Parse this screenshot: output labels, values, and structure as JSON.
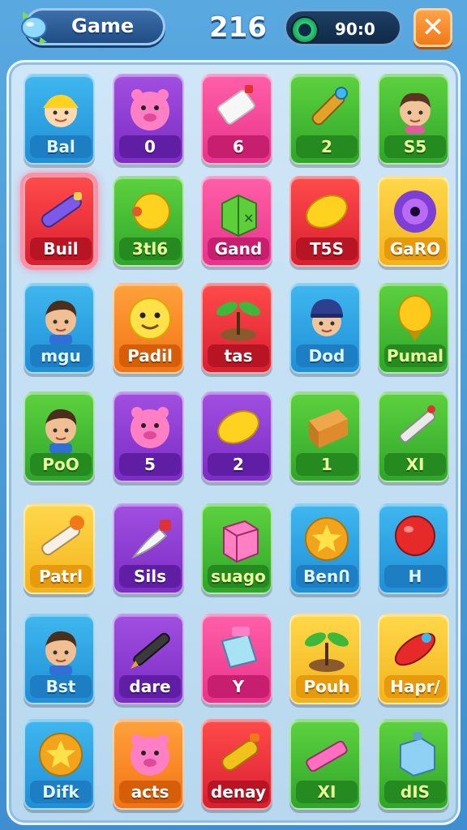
{
  "header": {
    "game_label": "Game",
    "score": "216",
    "timer": "90:0",
    "close_glyph": "✕"
  },
  "tiles": [
    {
      "label": "Bal",
      "color": "blue",
      "icon": "kid-face-icon"
    },
    {
      "label": "0",
      "color": "purple",
      "icon": "pink-pig-icon"
    },
    {
      "label": "6",
      "color": "pink",
      "icon": "eraser-icon"
    },
    {
      "label": "2",
      "color": "green",
      "icon": "flashlight-icon"
    },
    {
      "label": "S5",
      "color": "green",
      "icon": "boy-face-icon"
    },
    {
      "label": "Buil",
      "color": "red",
      "icon": "marker-pen-icon",
      "selected": true
    },
    {
      "label": "3tl6",
      "color": "green",
      "icon": "yellow-ball-icon"
    },
    {
      "label": "Gand",
      "color": "pink",
      "icon": "gift-box-icon"
    },
    {
      "label": "T5S",
      "color": "red",
      "icon": "lemon-icon"
    },
    {
      "label": "GaRO",
      "color": "yellow",
      "icon": "vinyl-disc-icon"
    },
    {
      "label": "mgu",
      "color": "blue",
      "icon": "man-face-icon"
    },
    {
      "label": "Padil",
      "color": "orange",
      "icon": "smiley-face-icon"
    },
    {
      "label": "tas",
      "color": "red",
      "icon": "sprout-icon"
    },
    {
      "label": "Dod",
      "color": "blue",
      "icon": "boy-cap-icon"
    },
    {
      "label": "Pumal",
      "color": "green",
      "icon": "golden-seed-icon"
    },
    {
      "label": "PoO",
      "color": "green",
      "icon": "man-face-icon"
    },
    {
      "label": "5",
      "color": "purple",
      "icon": "pink-pig-icon"
    },
    {
      "label": "2",
      "color": "purple",
      "icon": "lemon-icon"
    },
    {
      "label": "1",
      "color": "green",
      "icon": "box-icon"
    },
    {
      "label": "XI",
      "color": "green",
      "icon": "pen-icon"
    },
    {
      "label": "Patrl",
      "color": "yellow",
      "icon": "cigarette-icon"
    },
    {
      "label": "Sils",
      "color": "purple",
      "icon": "brush-icon"
    },
    {
      "label": "suago",
      "color": "green",
      "icon": "cube-icon"
    },
    {
      "label": "BenՈ",
      "color": "blue",
      "icon": "star-badge-icon"
    },
    {
      "label": "H",
      "color": "blue",
      "icon": "red-balloon-icon"
    },
    {
      "label": "Bst",
      "color": "blue",
      "icon": "man-face-icon"
    },
    {
      "label": "dare",
      "color": "purple",
      "icon": "fountain-pen-icon"
    },
    {
      "label": "Y",
      "color": "pink",
      "icon": "bag-icon"
    },
    {
      "label": "Pouh",
      "color": "yellow",
      "icon": "sprout-icon"
    },
    {
      "label": "Hapr/",
      "color": "yellow",
      "icon": "rocket-icon"
    },
    {
      "label": "Difk",
      "color": "blue",
      "icon": "star-badge-icon"
    },
    {
      "label": "acts",
      "color": "orange",
      "icon": "pink-pig-icon"
    },
    {
      "label": "denay",
      "color": "red",
      "icon": "bottle-icon"
    },
    {
      "label": "XI",
      "color": "green",
      "icon": "pink-marker-icon"
    },
    {
      "label": "dIS",
      "color": "green",
      "icon": "blue-cube-icon"
    }
  ]
}
